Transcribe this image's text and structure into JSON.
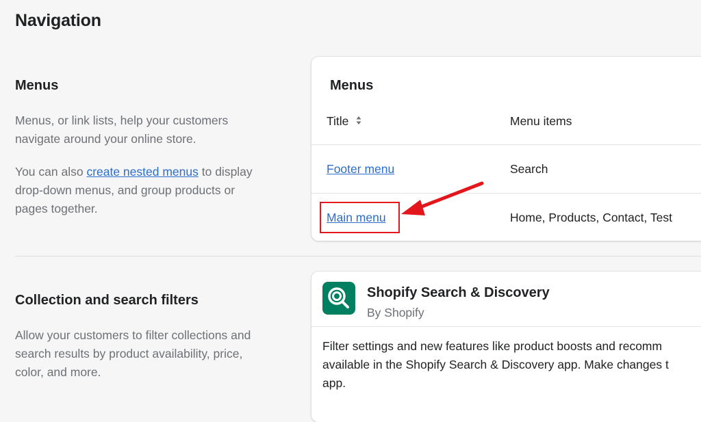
{
  "page": {
    "title": "Navigation"
  },
  "menus_section": {
    "heading": "Menus",
    "description": "Menus, or link lists, help your customers navigate around your online store.",
    "nested_prefix": "You can also ",
    "nested_link": "create nested menus",
    "nested_suffix": " to display drop-down menus, and group products or pages together."
  },
  "menus_card": {
    "title": "Menus",
    "columns": {
      "title": "Title",
      "items": "Menu items"
    },
    "rows": [
      {
        "title": "Footer menu",
        "items": "Search"
      },
      {
        "title": "Main menu",
        "items": "Home, Products, Contact, Test"
      }
    ]
  },
  "filters_section": {
    "heading": "Collection and search filters",
    "description": "Allow your customers to filter collections and search results by product availability, price, color, and more."
  },
  "app_card": {
    "name": "Shopify Search & Discovery",
    "by": "By Shopify",
    "description_lines": [
      "Filter settings and new features like product boosts and recomm",
      "available in the Shopify Search & Discovery app. Make changes t",
      "app."
    ]
  },
  "icons": {
    "sort": "sort-icon",
    "app": "search-discovery-app-icon",
    "annotation": "red-arrow-annotation"
  },
  "colors": {
    "link": "#2c6ecb",
    "annotation": "#e3161c",
    "app_icon_bg": "#008060"
  }
}
